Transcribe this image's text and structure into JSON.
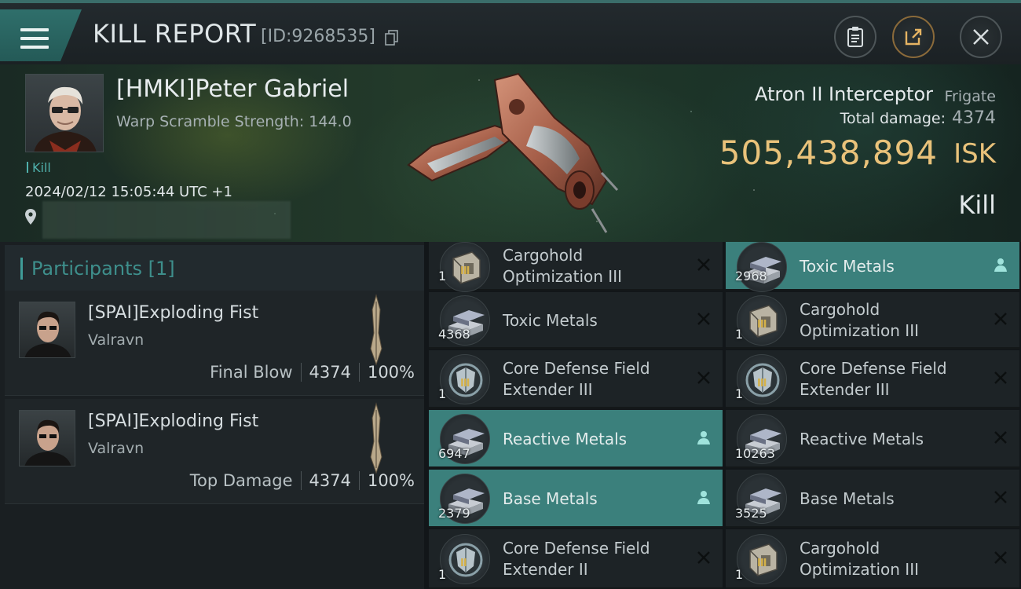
{
  "header": {
    "title": "KILL REPORT",
    "id_text": "[ID:9268535]"
  },
  "victim": {
    "name": "[HMKI]Peter Gabriel",
    "warp_scramble": "Warp Scramble Strength: 144.0",
    "tag": "Kill",
    "timestamp": "2024/02/12 15:05:44 UTC +1",
    "ship_name": "Atron II Interceptor",
    "ship_class": "Frigate",
    "total_damage_label": "Total damage:",
    "total_damage": "4374",
    "isk_value": "505,438,894",
    "isk_label": "ISK",
    "result": "Kill"
  },
  "participants": {
    "title": "Participants [1]",
    "rows": [
      {
        "name": "[SPAI]Exploding Fist",
        "ship": "Valravn",
        "role": "Final Blow",
        "damage": "4374",
        "percent": "100%"
      },
      {
        "name": "[SPAI]Exploding Fist",
        "ship": "Valravn",
        "role": "Top Damage",
        "damage": "4374",
        "percent": "100%"
      }
    ]
  },
  "items": [
    {
      "name": "Cargohold Optimization III",
      "qty": "1",
      "tier": "III",
      "icon": "cargohold-icon",
      "status": "destroyed"
    },
    {
      "name": "Toxic Metals",
      "qty": "2968",
      "tier": "",
      "icon": "metal-ingot-icon",
      "status": "dropped"
    },
    {
      "name": "Toxic Metals",
      "qty": "4368",
      "tier": "",
      "icon": "metal-ingot-icon",
      "status": "destroyed"
    },
    {
      "name": "Cargohold Optimization III",
      "qty": "1",
      "tier": "III",
      "icon": "cargohold-icon",
      "status": "destroyed"
    },
    {
      "name": "Core Defense Field Extender III",
      "qty": "1",
      "tier": "III",
      "icon": "shield-extender-icon",
      "status": "destroyed"
    },
    {
      "name": "Core Defense Field Extender III",
      "qty": "1",
      "tier": "III",
      "icon": "shield-extender-icon",
      "status": "destroyed"
    },
    {
      "name": "Reactive Metals",
      "qty": "6947",
      "tier": "",
      "icon": "metal-ingot-icon",
      "status": "dropped"
    },
    {
      "name": "Reactive Metals",
      "qty": "10263",
      "tier": "",
      "icon": "metal-ingot-icon",
      "status": "destroyed"
    },
    {
      "name": "Base Metals",
      "qty": "2379",
      "tier": "",
      "icon": "metal-ingot-icon",
      "status": "dropped"
    },
    {
      "name": "Base Metals",
      "qty": "3525",
      "tier": "",
      "icon": "metal-ingot-icon",
      "status": "destroyed"
    },
    {
      "name": "Core Defense Field Extender II",
      "qty": "1",
      "tier": "II",
      "icon": "shield-extender-icon",
      "status": "destroyed"
    },
    {
      "name": "Cargohold Optimization III",
      "qty": "1",
      "tier": "III",
      "icon": "cargohold-icon",
      "status": "destroyed"
    }
  ],
  "colors": {
    "accent": "#3f9b97",
    "dropped_row": "#3b807c",
    "isk": "#e9c27a"
  }
}
